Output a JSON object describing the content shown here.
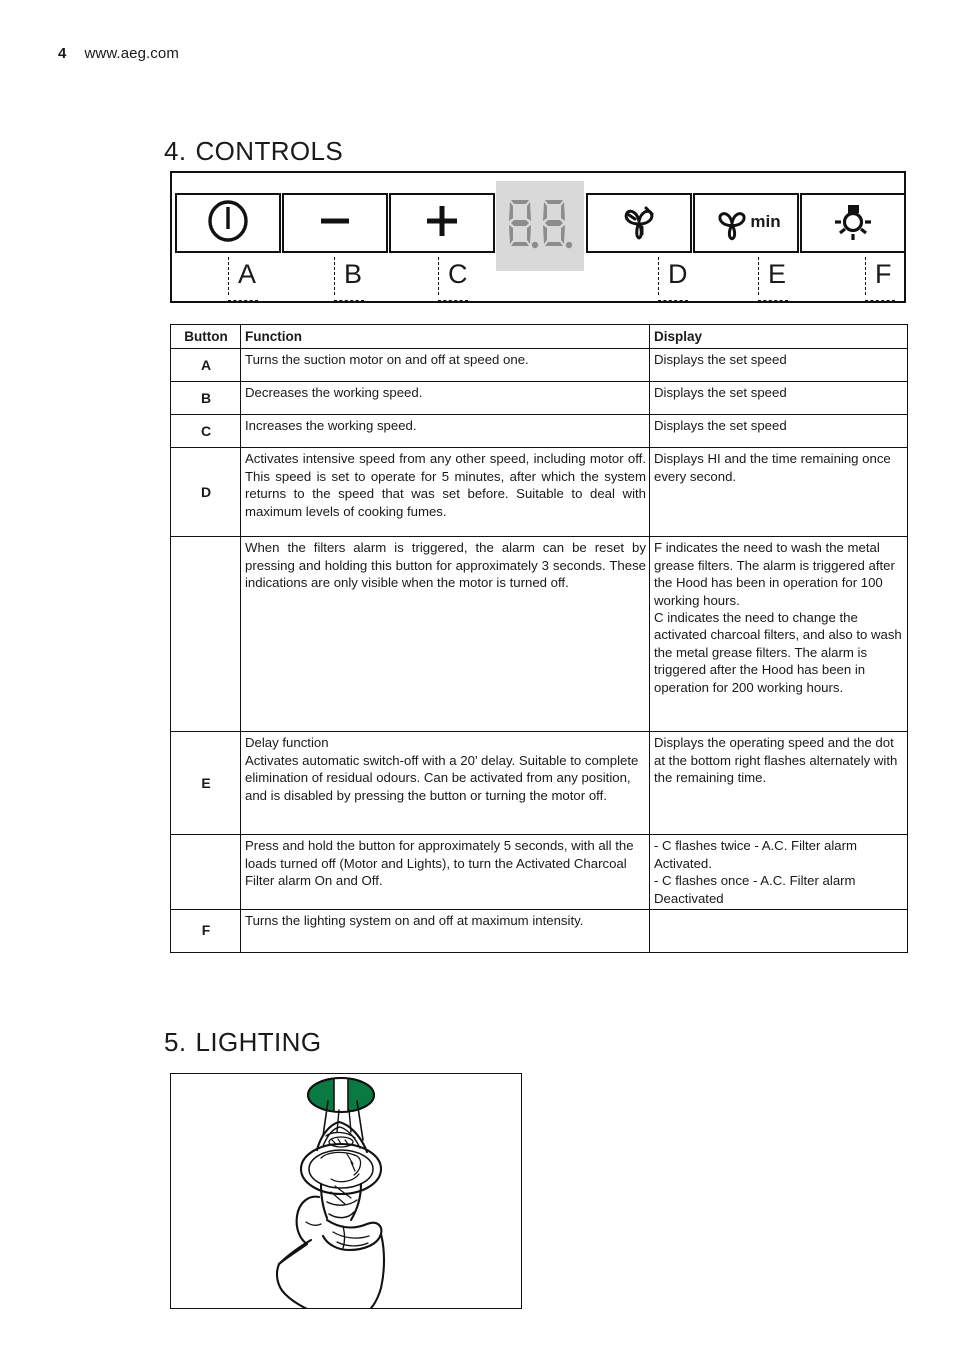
{
  "page": {
    "number": "4",
    "site": "www.aeg.com"
  },
  "sections": {
    "controls": {
      "num": "4.",
      "title": "CONTROLS"
    },
    "lighting": {
      "num": "5.",
      "title": "LIGHTING"
    }
  },
  "panel": {
    "display_value": "8.8.",
    "min_label": "min",
    "buttons": [
      {
        "id": "A",
        "icon": "power-icon",
        "label": "A"
      },
      {
        "id": "B",
        "icon": "minus-icon",
        "label": "B"
      },
      {
        "id": "C",
        "icon": "plus-icon",
        "label": "C"
      },
      {
        "id": "D",
        "icon": "fan-intensive-icon",
        "label": "D"
      },
      {
        "id": "E",
        "icon": "fan-timer-icon",
        "label": "E"
      },
      {
        "id": "F",
        "icon": "lamp-icon",
        "label": "F"
      }
    ]
  },
  "table": {
    "headers": {
      "button": "Button",
      "function": "Function",
      "display": "Display"
    },
    "rows": [
      {
        "button": "A",
        "function": "Turns the suction motor on and off at speed one.",
        "display": "Displays the set speed"
      },
      {
        "button": "B",
        "function": "Decreases the working speed.",
        "display": "Displays the set speed"
      },
      {
        "button": "C",
        "function": "Increases the working speed.",
        "display": "Displays the set speed"
      },
      {
        "button": "D",
        "function": "Activates intensive speed from any other speed, including motor off. This speed is set to operate for 5 minutes, after which the system returns to the speed that was set before. Suitable to deal with maximum levels of cooking fumes.",
        "display": "Displays HI and the time remaining once every second."
      },
      {
        "button": "",
        "function": "When the filters alarm is triggered, the alarm can be reset by pressing and holding this button for approximately 3 seconds. These indications are only visible when the motor is turned off.",
        "display": "F  indicates the need to wash the metal grease filters. The alarm is triggered after the Hood has been in operation for 100 working hours.\nC  indicates the need to change the activated charcoal filters, and also to wash the metal grease filters. The alarm is triggered after the Hood has been in operation for 200 working hours."
      },
      {
        "button": "E",
        "function": "Delay function\nActivates automatic switch-off with a 20’ delay. Suitable to complete elimination of residual odours. Can be activated from any position, and is disabled by pressing the button or turning the motor off.",
        "display": "Displays the operating speed and the dot at the bottom right flashes alternately with the remaining time."
      },
      {
        "button": "",
        "function": "Press and hold the button for approximately 5 seconds, with all the loads turned off (Motor and Lights), to turn the Activated Charcoal Filter alarm On and Off.",
        "display": "- C flashes twice - A.C. Filter alarm Activated.\n- C flashes once - A.C. Filter alarm Deactivated"
      },
      {
        "button": "F",
        "function": "Turns the lighting system on and off at maximum intensity.",
        "display": ""
      }
    ]
  },
  "figure": {
    "name": "hand-replacing-lamp-illustration",
    "accent_color": "#0a7a42"
  }
}
